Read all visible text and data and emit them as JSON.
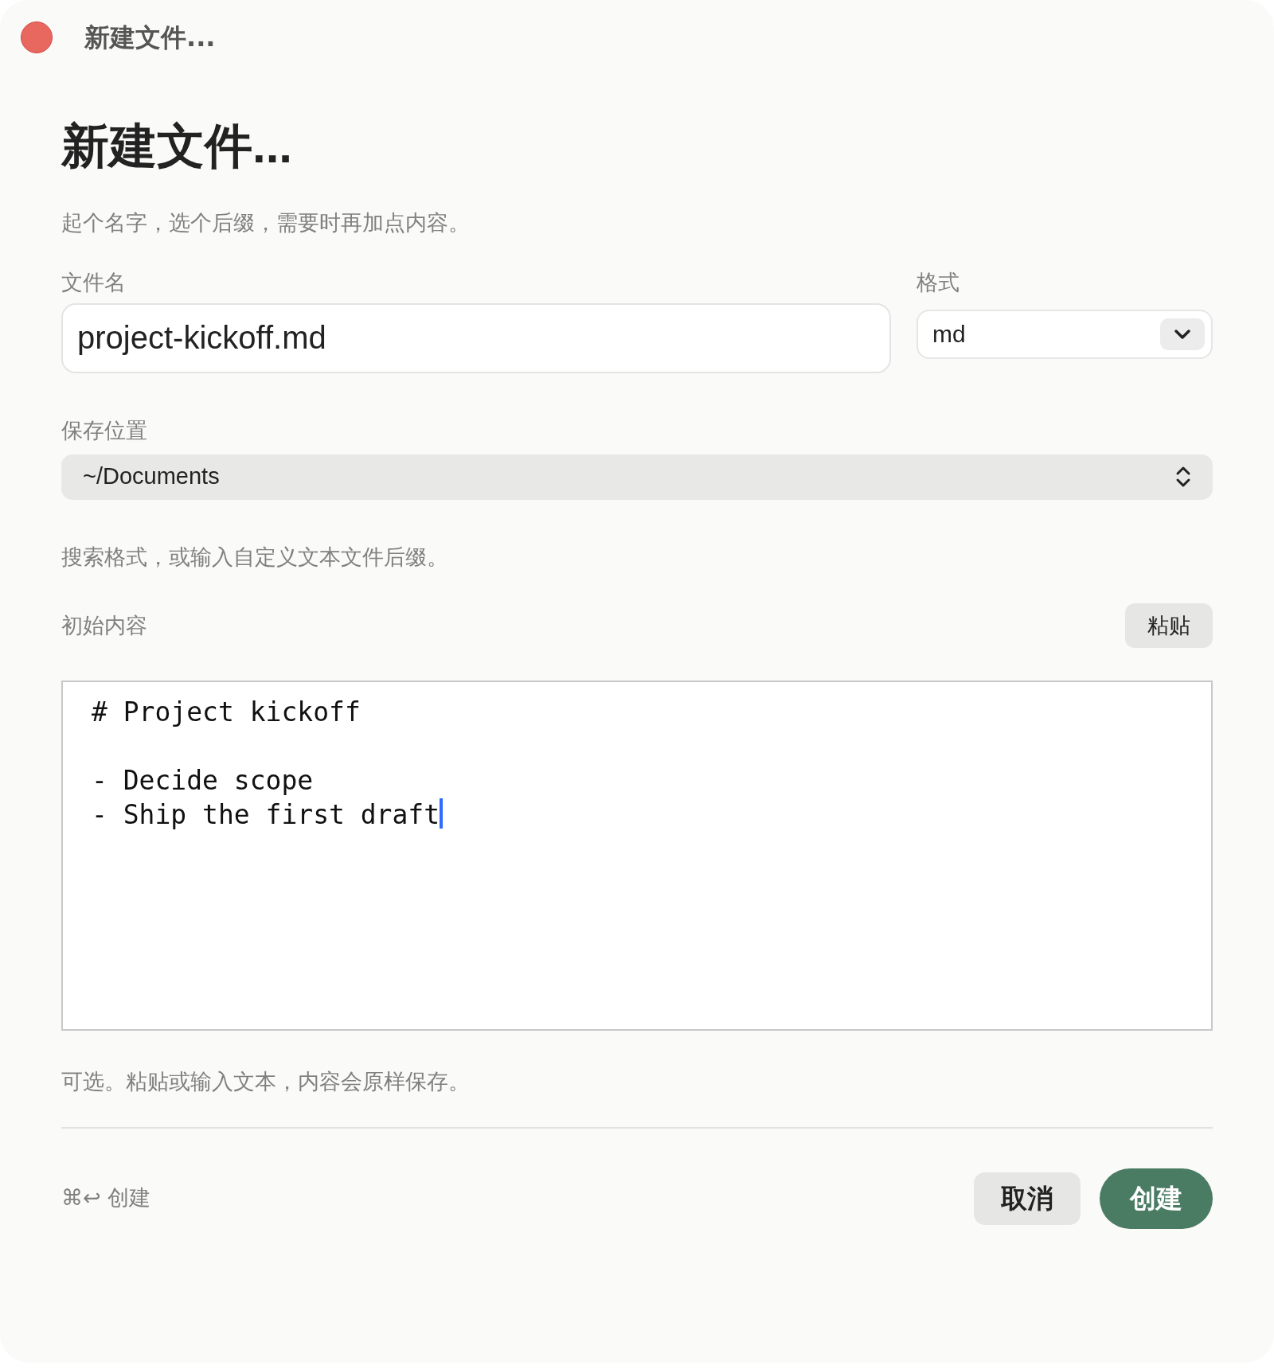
{
  "window": {
    "title": "新建文件..."
  },
  "heading": "新建文件...",
  "subtitle": "起个名字，选个后缀，需要时再加点内容。",
  "filename": {
    "label": "文件名",
    "value": "project-kickoff.md"
  },
  "format": {
    "label": "格式",
    "value": "md"
  },
  "location": {
    "label": "保存位置",
    "value": "~/Documents",
    "hint": "搜索格式，或输入自定义文本文件后缀。"
  },
  "content": {
    "label": "初始内容",
    "paste_button": "粘贴",
    "value": "# Project kickoff\n\n- Decide scope\n- Ship the first draft",
    "hint": "可选。粘贴或输入文本，内容会原样保存。"
  },
  "footer": {
    "shortcut": "⌘↩ 创建",
    "buttons": [
      {
        "label": "取消",
        "kind": "secondary"
      },
      {
        "label": "创建",
        "kind": "primary"
      }
    ]
  }
}
